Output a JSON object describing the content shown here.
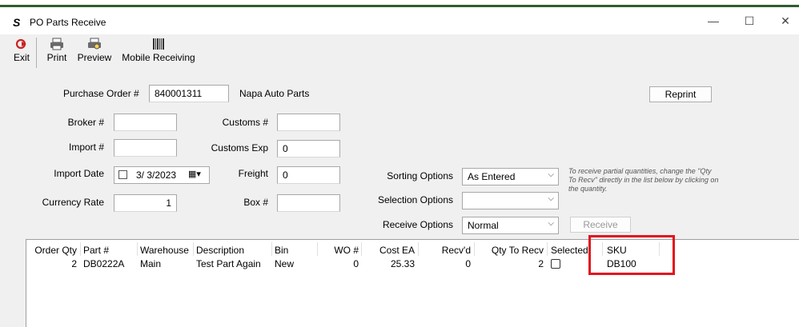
{
  "window": {
    "title": "PO Parts Receive",
    "logo": "S",
    "min": "—",
    "max": "☐",
    "close": "✕"
  },
  "toolbar": {
    "exit": {
      "label": "Exit",
      "icon": "exit-icon"
    },
    "print": {
      "label": "Print",
      "icon": "printer-icon"
    },
    "preview": {
      "label": "Preview",
      "icon": "preview-icon"
    },
    "mobile": {
      "label": "Mobile Receiving",
      "icon": "barcode-icon"
    }
  },
  "form": {
    "po_label": "Purchase Order #",
    "po_value": "840001311",
    "vendor": "Napa Auto Parts",
    "reprint": "Reprint",
    "broker_label": "Broker #",
    "broker_value": "",
    "customs_label": "Customs #",
    "customs_value": "",
    "import_label": "Import #",
    "import_value": "",
    "customs_exp_label": "Customs Exp",
    "customs_exp_value": "0",
    "import_date_label": "Import Date",
    "import_date_value": "3/ 3/2023",
    "freight_label": "Freight",
    "freight_value": "0",
    "currency_label": "Currency Rate",
    "currency_value": "1",
    "box_label": "Box #",
    "box_value": "",
    "sorting_label": "Sorting Options",
    "sorting_value": "As Entered",
    "selection_label": "Selection Options",
    "selection_value": "",
    "receive_opt_label": "Receive Options",
    "receive_opt_value": "Normal",
    "receive_btn": "Receive",
    "hint": "To receive partial quantities, change the \"Qty To Recv\" directly in the list below by clicking on the quantity."
  },
  "grid": {
    "headers": {
      "order_qty": "Order Qty",
      "part": "Part #",
      "warehouse": "Warehouse",
      "description": "Description",
      "bin": "Bin",
      "wo": "WO #",
      "cost": "Cost EA",
      "recvd": "Recv'd",
      "qty_recv": "Qty To Recv",
      "selected": "Selected",
      "sku": "SKU"
    },
    "rows": [
      {
        "order_qty": "2",
        "part": "DB0222A",
        "warehouse": "Main",
        "description": "Test Part Again",
        "bin": "New",
        "wo": "0",
        "cost": "25.33",
        "recvd": "0",
        "qty_recv": "2",
        "selected": false,
        "sku": "DB100"
      }
    ]
  },
  "colors": {
    "highlight": "#e0151f",
    "exit_icon": "#cc2222"
  }
}
